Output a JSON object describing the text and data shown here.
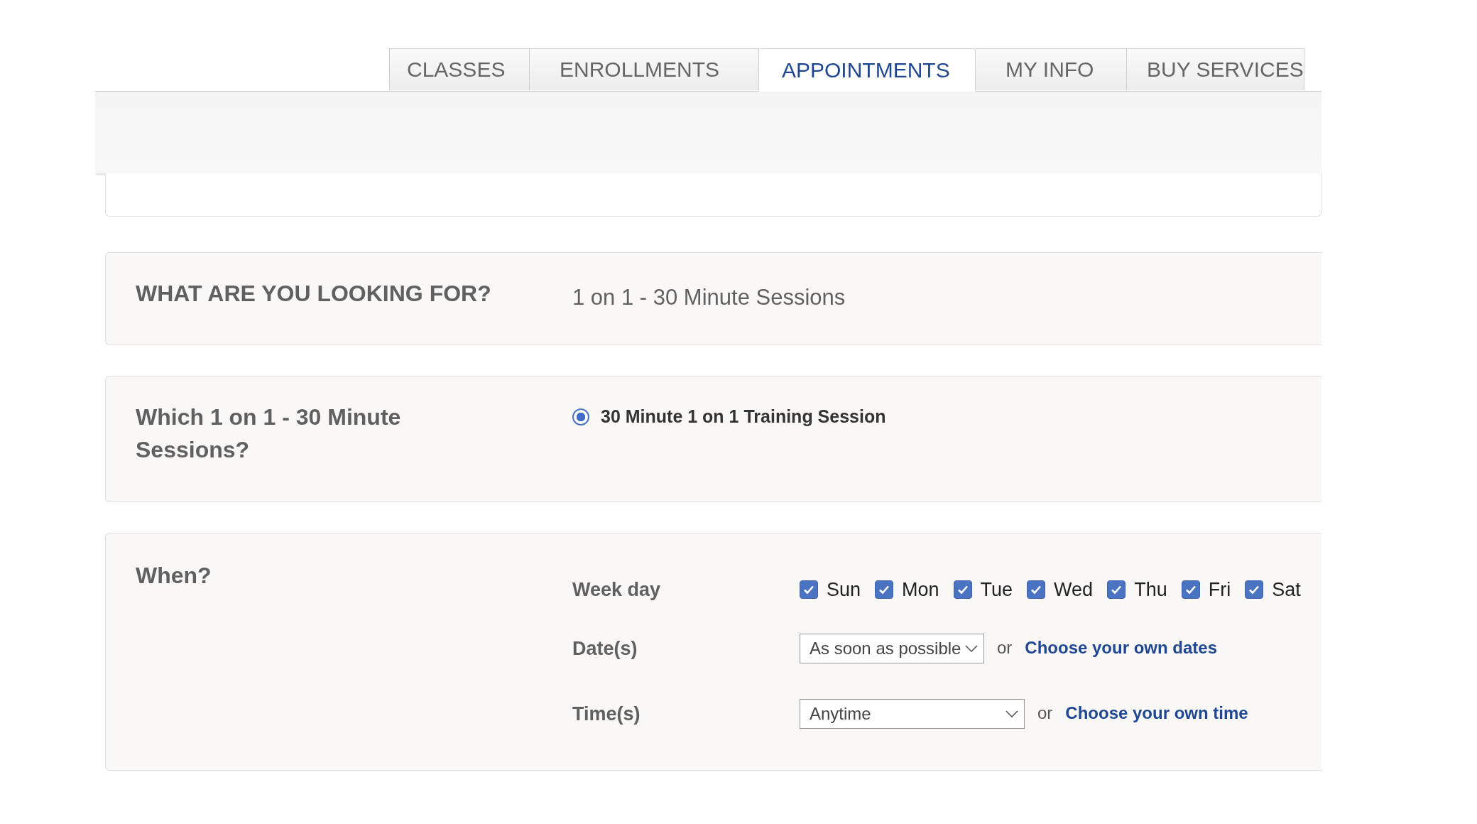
{
  "tabs": [
    {
      "label": "CLASSES",
      "selected": false
    },
    {
      "label": "ENROLLMENTS",
      "selected": false
    },
    {
      "label": "APPOINTMENTS",
      "selected": true
    },
    {
      "label": "MY INFO",
      "selected": false
    },
    {
      "label": "BUY SERVICES",
      "selected": false
    }
  ],
  "looking_for": {
    "heading": "WHAT ARE YOU LOOKING FOR?",
    "value": "1 on 1 - 30 Minute Sessions"
  },
  "which": {
    "heading": "Which 1 on 1 - 30 Minute Sessions?",
    "options": [
      {
        "label": "30 Minute 1 on 1 Training Session",
        "selected": true
      }
    ]
  },
  "when": {
    "heading": "When?",
    "week_day": {
      "label": "Week day",
      "days": [
        {
          "label": "Sun",
          "checked": true
        },
        {
          "label": "Mon",
          "checked": true
        },
        {
          "label": "Tue",
          "checked": true
        },
        {
          "label": "Wed",
          "checked": true
        },
        {
          "label": "Thu",
          "checked": true
        },
        {
          "label": "Fri",
          "checked": true
        },
        {
          "label": "Sat",
          "checked": true
        }
      ]
    },
    "dates": {
      "label": "Date(s)",
      "value": "As soon as possible",
      "or": "or",
      "link": "Choose your own dates"
    },
    "times": {
      "label": "Time(s)",
      "value": "Anytime",
      "or": "or",
      "link": "Choose your own time"
    }
  }
}
